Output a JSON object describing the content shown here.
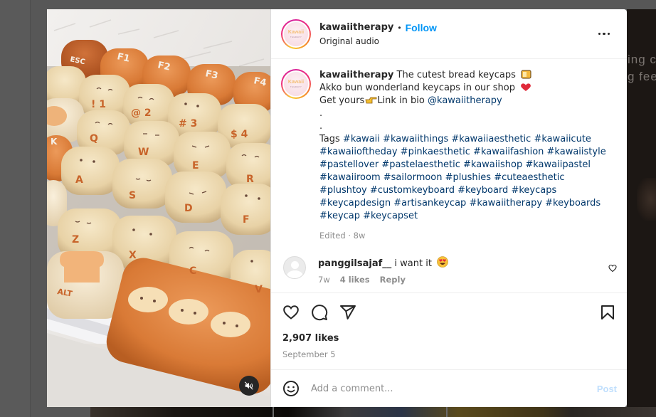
{
  "post": {
    "author": "kawaiitherapy",
    "avatar_text": "Kawaii",
    "avatar_subtext": "THERAPY",
    "separator": "•",
    "follow_label": "Follow",
    "audio_label": "Original audio",
    "more_icon": "more-horizontal-icon",
    "mute_icon": "volume-muted-icon"
  },
  "caption": {
    "author": "kawaiitherapy",
    "line1": "The cutest bread keycaps",
    "line1_emoji": "bread-emoji",
    "line2": "Akko bun wonderland keycaps in our shop",
    "line2_emoji": "heart-emoji",
    "line3_prefix": "Get yours",
    "line3_emoji": "pointing-hand-emoji",
    "line3_suffix": "Link in bio",
    "mention": "@kawaiitherapy",
    "dot1": ".",
    "dot2": ".",
    "tags_label": "Tags",
    "hashtags": [
      "#kawaii",
      "#kawaiithings",
      "#kawaiiaesthetic",
      "#kawaiicute",
      "#kawaiioftheday",
      "#pinkaesthetic",
      "#kawaiifashion",
      "#kawaiistyle",
      "#pastellover",
      "#pastelaesthetic",
      "#kawaiishop",
      "#kawaiipastel",
      "#kawaiiroom",
      "#sailormoon",
      "#plushies",
      "#cuteaesthetic",
      "#plushtoy",
      "#customkeyboard",
      "#keyboard",
      "#keycaps",
      "#keycapdesign",
      "#artisankeycap",
      "#kawaiitherapy",
      "#keyboards",
      "#keycap",
      "#keycapset"
    ],
    "edited_label": "Edited",
    "meta_sep": "·",
    "age": "8w"
  },
  "comments": [
    {
      "user": "panggilsajaf__",
      "text": "i want it",
      "emoji": "heart-eyes-emoji",
      "age": "7w",
      "likes": "4 likes",
      "reply_label": "Reply"
    }
  ],
  "actions": {
    "like_icon": "heart-icon",
    "comment_icon": "comment-icon",
    "share_icon": "share-icon",
    "save_icon": "bookmark-icon"
  },
  "likes_text": "2,907 likes",
  "date_text": "September 5",
  "comment_box": {
    "placeholder": "Add a comment...",
    "post_label": "Post",
    "emoji_icon": "smiley-icon"
  },
  "background": {
    "right_text_line1": "ing c",
    "right_text_line2": "g fee"
  },
  "media": {
    "keycap_labels": [
      "ESC",
      "F1",
      "F2",
      "F3",
      "F4",
      "!1",
      "@2",
      "#3",
      "$4",
      "Q",
      "W",
      "E",
      "R",
      "A",
      "S",
      "D",
      "F",
      "Z",
      "X",
      "C",
      "V",
      "ALT"
    ]
  },
  "colors": {
    "accent": "#0095f6",
    "hashtag": "#00376b",
    "muted": "#8e8e8e",
    "post_disabled": "#c0dffd"
  }
}
